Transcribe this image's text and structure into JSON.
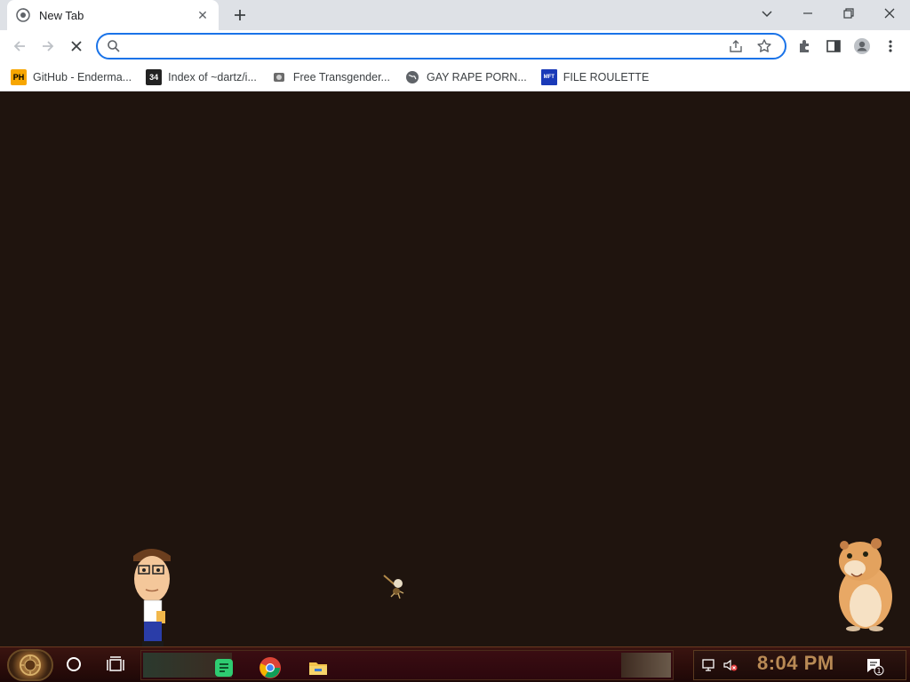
{
  "tab": {
    "title": "New Tab",
    "close_glyph": "✕"
  },
  "window": {
    "new_tab_glyph": "+",
    "tab_search_glyph": "⌵",
    "minimize_glyph": "—",
    "restore_glyph": "❐",
    "close_glyph": "✕"
  },
  "omnibox": {
    "value": "",
    "placeholder": ""
  },
  "bookmarks": [
    {
      "icon_text": "PH",
      "label": "GitHub - Enderma..."
    },
    {
      "icon_text": "34",
      "label": "Index of ~dartz/i..."
    },
    {
      "icon_text": "",
      "label": "Free Transgender..."
    },
    {
      "icon_text": "",
      "label": "GAY RAPE PORN..."
    },
    {
      "icon_text": "MFT",
      "label": "FILE ROULETTE"
    }
  ],
  "taskbar": {
    "clock": "8:04 PM"
  },
  "colors": {
    "accent": "#1a73e8",
    "desktop_bg": "#1f140e",
    "clock": "#b98a55"
  }
}
